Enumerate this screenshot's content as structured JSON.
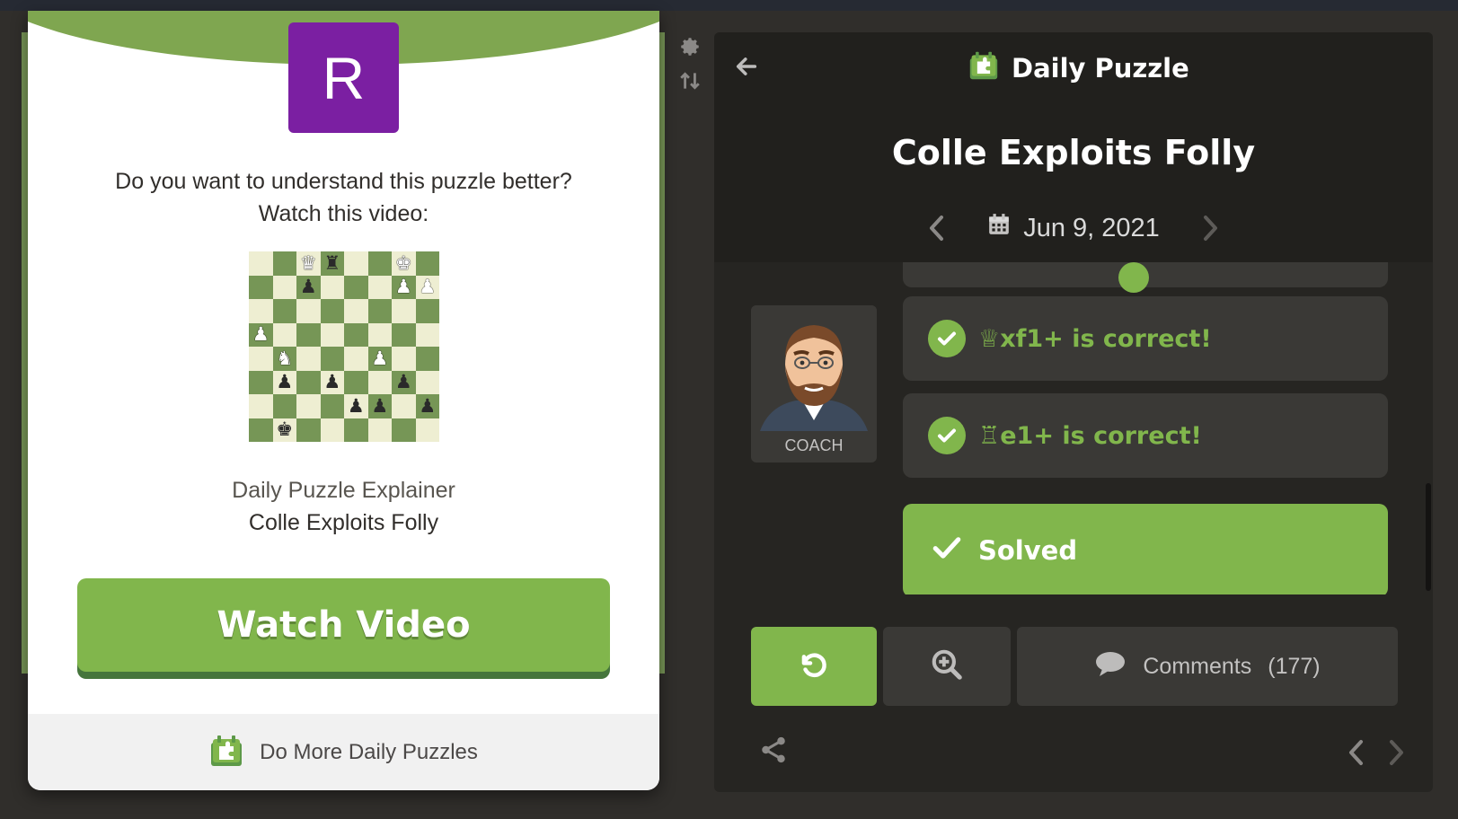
{
  "modal": {
    "avatar_letter": "R",
    "question_line1": "Do you want to understand this puzzle better?",
    "question_line2": "Watch this video:",
    "explainer_label": "Daily Puzzle Explainer",
    "explainer_title": "Colle Exploits Folly",
    "watch_button": "Watch Video",
    "footer_link": "Do More Daily Puzzles",
    "mini_board": [
      [
        "",
        "",
        "wQ",
        "bR",
        "",
        "",
        "wK",
        ""
      ],
      [
        "",
        "",
        "bP",
        "",
        "",
        "",
        "wP",
        "wP"
      ],
      [
        "",
        "",
        "",
        "",
        "",
        "",
        "",
        ""
      ],
      [
        "wP",
        "",
        "",
        "",
        "",
        "",
        "",
        ""
      ],
      [
        "",
        "wN",
        "",
        "",
        "",
        "wP",
        "",
        ""
      ],
      [
        "",
        "bP",
        "",
        "bP",
        "",
        "",
        "bP",
        ""
      ],
      [
        "",
        "",
        "",
        "",
        "bP",
        "bP",
        "",
        "bP"
      ],
      [
        "",
        "bK",
        "",
        "",
        "",
        "",
        "",
        ""
      ]
    ]
  },
  "panel": {
    "header_title": "Daily Puzzle",
    "puzzle_name": "Colle Exploits Folly",
    "date": "Jun 9, 2021",
    "coach_label": "COACH",
    "messages": [
      {
        "piece": "♕",
        "text": "xf1+ is correct!"
      },
      {
        "piece": "♖",
        "text": "e1+ is correct!"
      }
    ],
    "solved_label": "Solved",
    "comments_label": "Comments",
    "comments_count": "(177)"
  },
  "colors": {
    "accent_green": "#81b64c",
    "panel_bg": "#262522",
    "card_bg": "#3a3936",
    "avatar_purple": "#7b1fa2"
  },
  "icons": [
    "gear-icon",
    "flip-board-icon",
    "back-arrow-icon",
    "daily-puzzle-icon",
    "calendar-icon",
    "chevron-left-icon",
    "chevron-right-icon",
    "check-icon",
    "retry-icon",
    "analysis-icon",
    "comment-icon",
    "share-icon"
  ]
}
